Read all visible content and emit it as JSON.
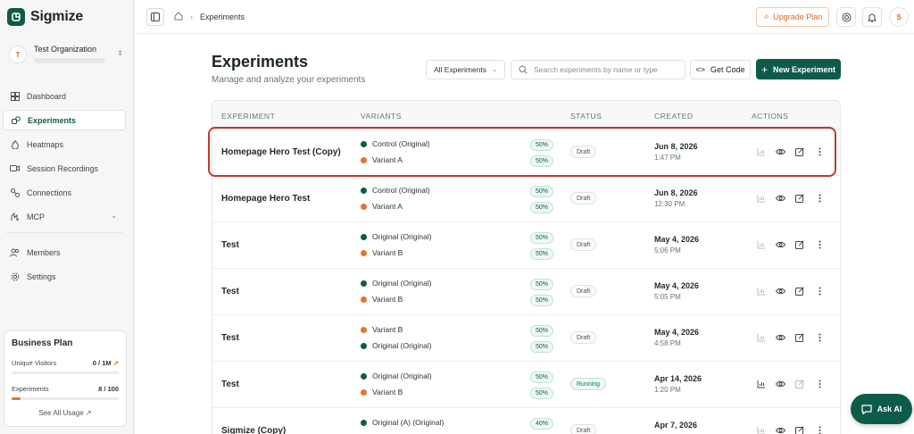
{
  "brand": {
    "name": "Sigmize"
  },
  "org": {
    "initial": "T",
    "name": "Test Organization"
  },
  "nav": {
    "dashboard": "Dashboard",
    "experiments": "Experiments",
    "heatmaps": "Heatmaps",
    "session_recordings": "Session Recordings",
    "connections": "Connections",
    "mcp": "MCP",
    "members": "Members",
    "settings": "Settings"
  },
  "plan": {
    "title": "Business Plan",
    "unique_visitors_label": "Unique Visitors",
    "unique_visitors_value": "0 / 1M",
    "experiments_label": "Experiments",
    "experiments_value": "8 / 100",
    "experiments_fraction": 0.08,
    "see_all": "See All Usage"
  },
  "topbar": {
    "breadcrumb": "Experiments",
    "upgrade": "Upgrade Plan",
    "user_initial": "S"
  },
  "main": {
    "title": "Experiments",
    "subtitle": "Manage and analyze your experiments",
    "filter": "All Experiments",
    "search_placeholder": "Search experiments by name or type",
    "get_code": "Get Code",
    "new_experiment": "New Experiment"
  },
  "table": {
    "headers": {
      "experiment": "EXPERIMENT",
      "variants": "VARIANTS",
      "status": "STATUS",
      "created": "CREATED",
      "actions": "ACTIONS"
    },
    "rows": [
      {
        "name": "Homepage Hero Test (Copy)",
        "v1": "Control (Original)",
        "p1": "50%",
        "v2": "Variant A",
        "p2": "50%",
        "status": "Draft",
        "date": "Jun 8, 2026",
        "time": "1:47 PM"
      },
      {
        "name": "Homepage Hero Test",
        "v1": "Control (Original)",
        "p1": "50%",
        "v2": "Variant A",
        "p2": "50%",
        "status": "Draft",
        "date": "Jun 8, 2026",
        "time": "12:30 PM"
      },
      {
        "name": "Test",
        "v1": "Original (Original)",
        "p1": "50%",
        "v2": "Variant B",
        "p2": "50%",
        "status": "Draft",
        "date": "May 4, 2026",
        "time": "5:06 PM"
      },
      {
        "name": "Test",
        "v1": "Original (Original)",
        "p1": "50%",
        "v2": "Variant B",
        "p2": "50%",
        "status": "Draft",
        "date": "May 4, 2026",
        "time": "5:05 PM"
      },
      {
        "name": "Test",
        "v1": "Variant B",
        "p1": "50%",
        "v2": "Original (Original)",
        "p2": "50%",
        "status": "Draft",
        "date": "May 4, 2026",
        "time": "4:58 PM"
      },
      {
        "name": "Test",
        "v1": "Original (Original)",
        "p1": "50%",
        "v2": "Variant B",
        "p2": "50%",
        "status": "Running",
        "date": "Apr 14, 2026",
        "time": "1:20 PM"
      },
      {
        "name": "Sigmize (Copy)",
        "v1": "Original (A) (Original)",
        "p1": "40%",
        "v2": "",
        "p2": "",
        "status": "Draft",
        "date": "Apr 7, 2026",
        "time": ""
      }
    ]
  },
  "ask_ai": "Ask AI",
  "colors": {
    "brand": "#0f5b4a",
    "accent_orange": "#e8732e",
    "highlight_red": "#c0392b"
  }
}
